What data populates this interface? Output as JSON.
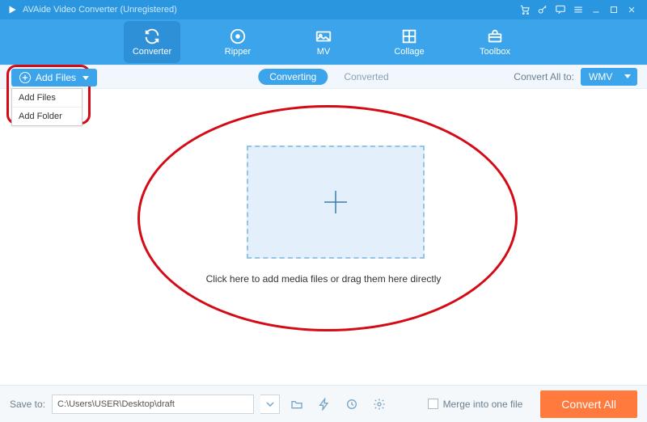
{
  "titlebar": {
    "app_title": "AVAide Video Converter (Unregistered)"
  },
  "nav": {
    "items": [
      {
        "label": "Converter"
      },
      {
        "label": "Ripper"
      },
      {
        "label": "MV"
      },
      {
        "label": "Collage"
      },
      {
        "label": "Toolbox"
      }
    ]
  },
  "subbar": {
    "add_files_label": "Add Files",
    "menu": {
      "add_files": "Add Files",
      "add_folder": "Add Folder"
    },
    "tabs": {
      "converting": "Converting",
      "converted": "Converted"
    },
    "convert_all_to_label": "Convert All to:",
    "selected_format": "WMV"
  },
  "main": {
    "hint": "Click here to add media files or drag them here directly"
  },
  "bottom": {
    "save_to_label": "Save to:",
    "save_path": "C:\\Users\\USER\\Desktop\\draft",
    "merge_label": "Merge into one file",
    "convert_all_label": "Convert All"
  },
  "colors": {
    "accent": "#3ba4eb",
    "accent_dark": "#2a96e0",
    "annotation": "#d40b17",
    "cta": "#ff7a3c"
  }
}
